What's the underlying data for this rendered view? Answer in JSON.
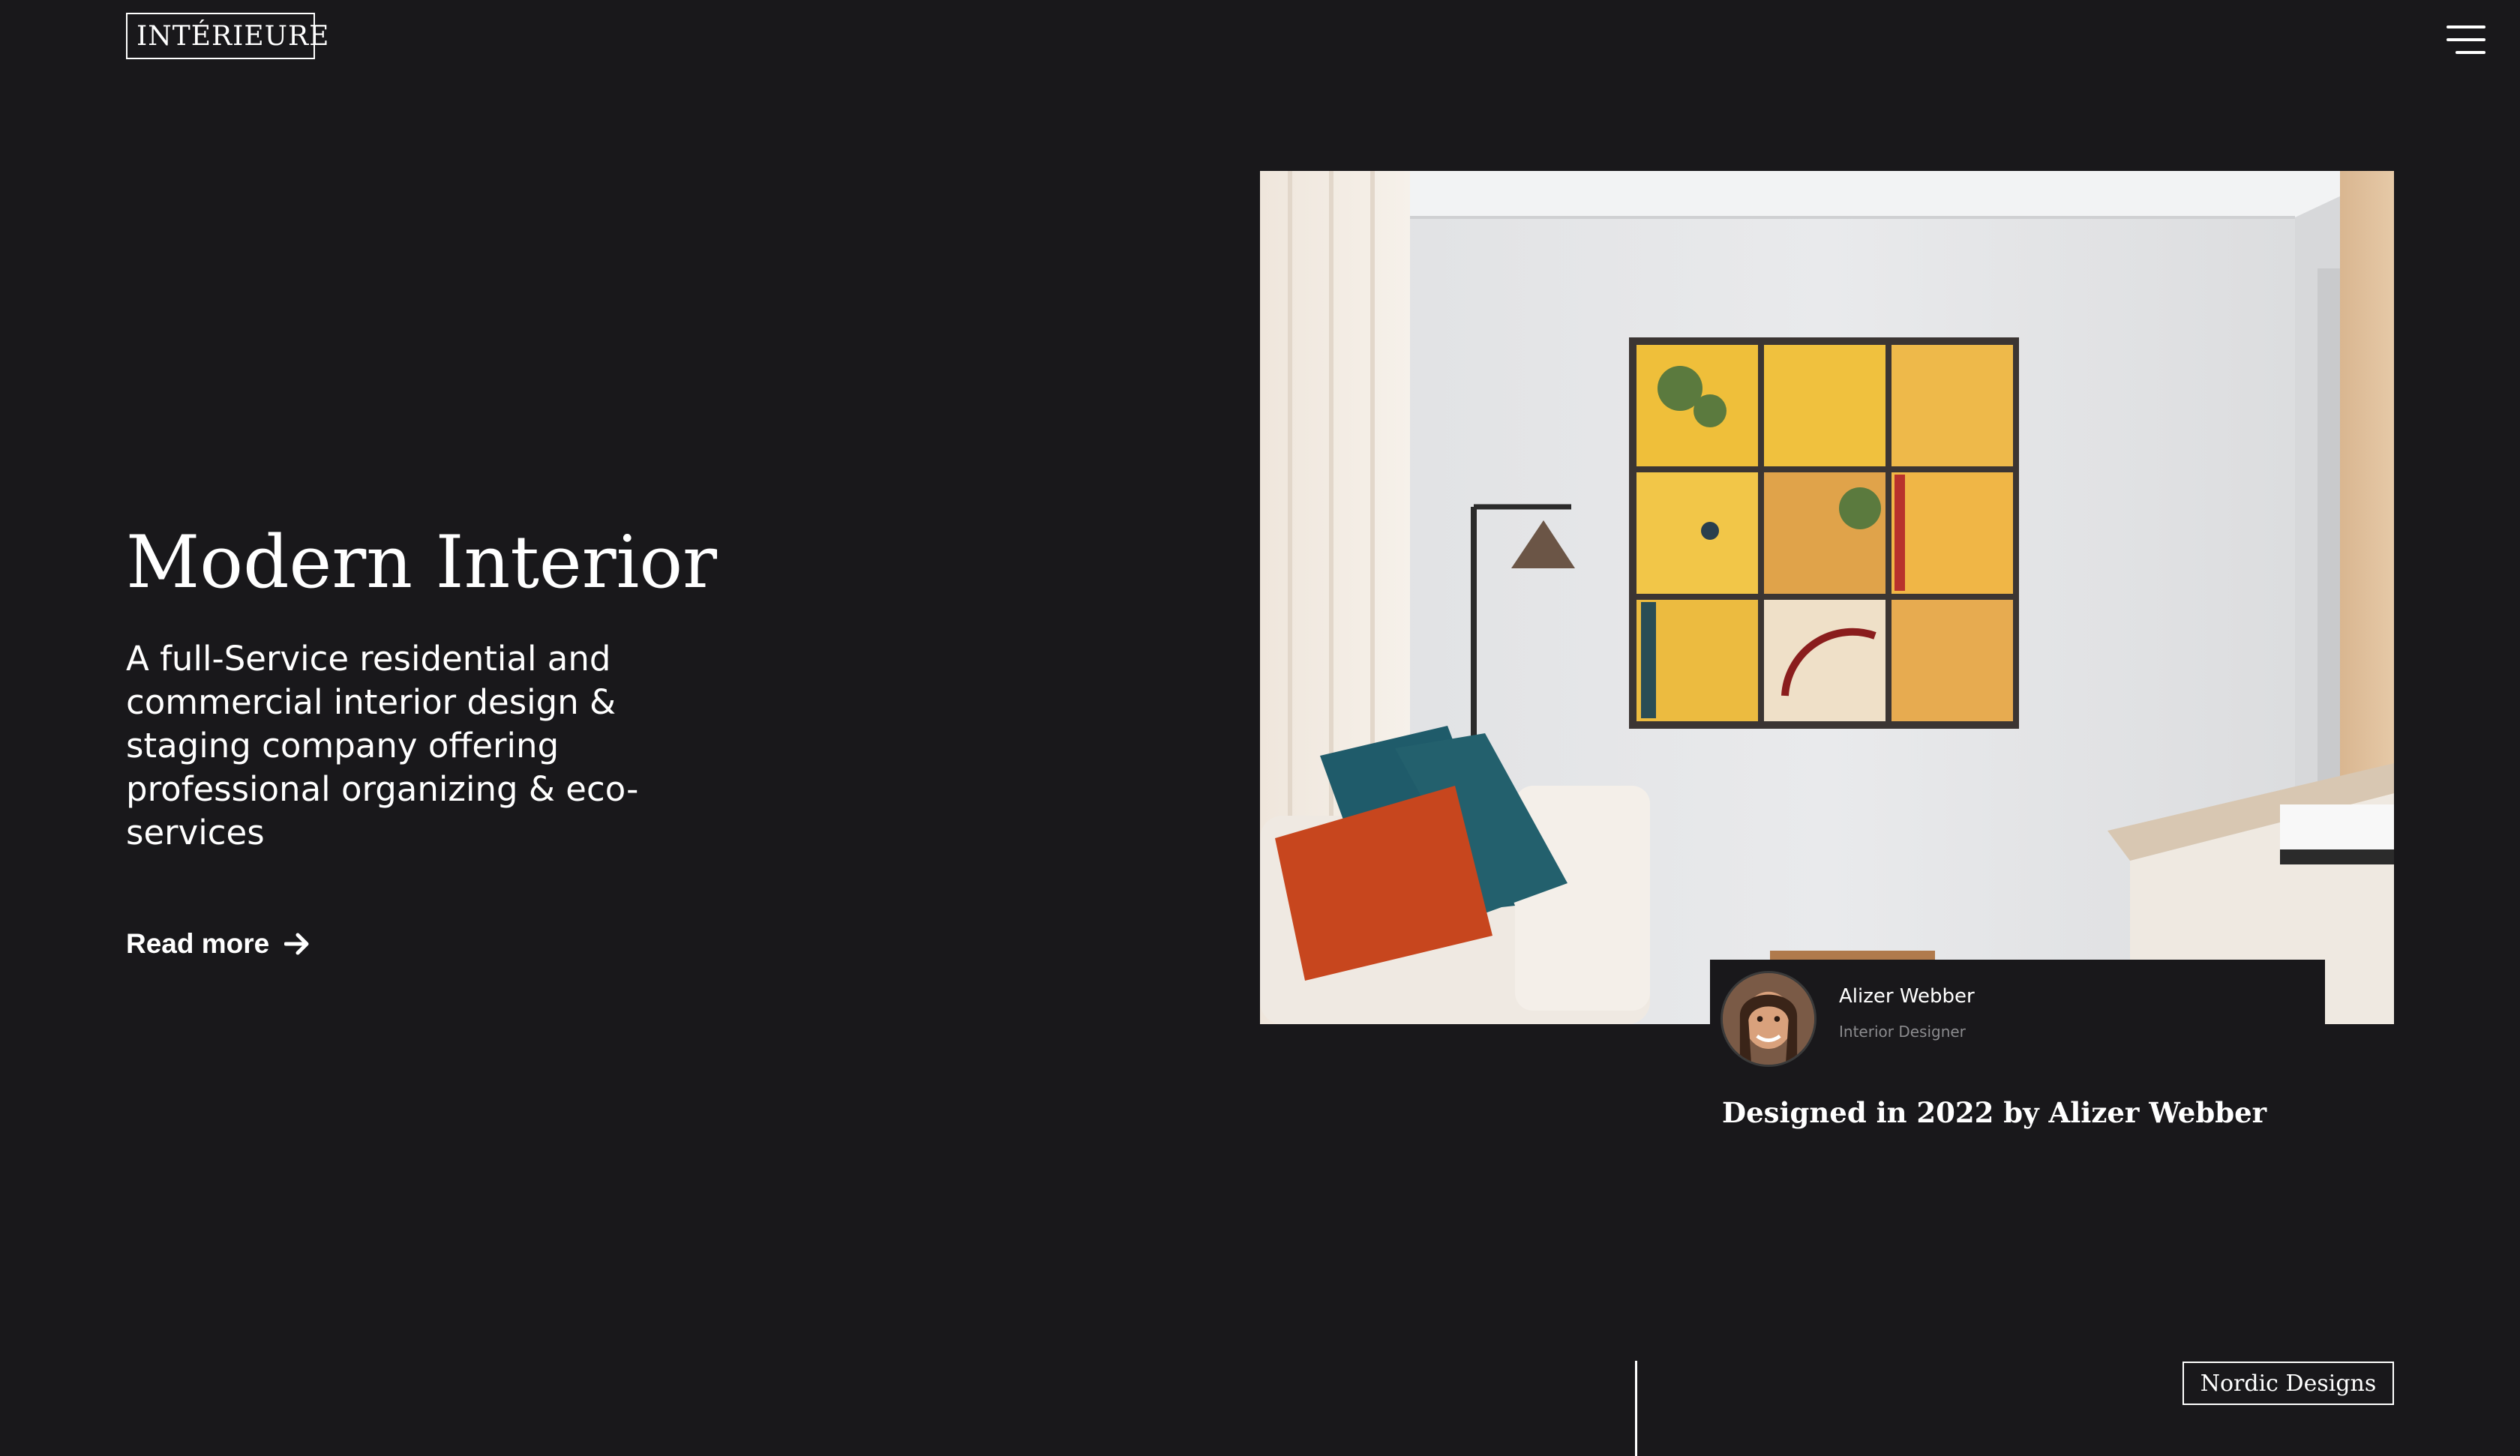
{
  "theme": {
    "background": "#19181b",
    "accent": "#e4542d"
  },
  "header": {
    "logo_text": "INTÉRIEURE",
    "menu_icon": "hamburger-menu-icon"
  },
  "hero": {
    "title": "Modern Interior",
    "description": "A full-Service residential and commercial interior design & staging company offering professional organizing & eco-services",
    "read_more_label": "Read more",
    "read_more_icon": "arrow-right-icon"
  },
  "featured": {
    "designer_name": "Alizer Webber",
    "designer_role": "Interior Designer",
    "caption": "Designed in 2022 by Alizer Webber"
  },
  "footer_strip": {
    "tag_label": "Nordic Designs"
  }
}
